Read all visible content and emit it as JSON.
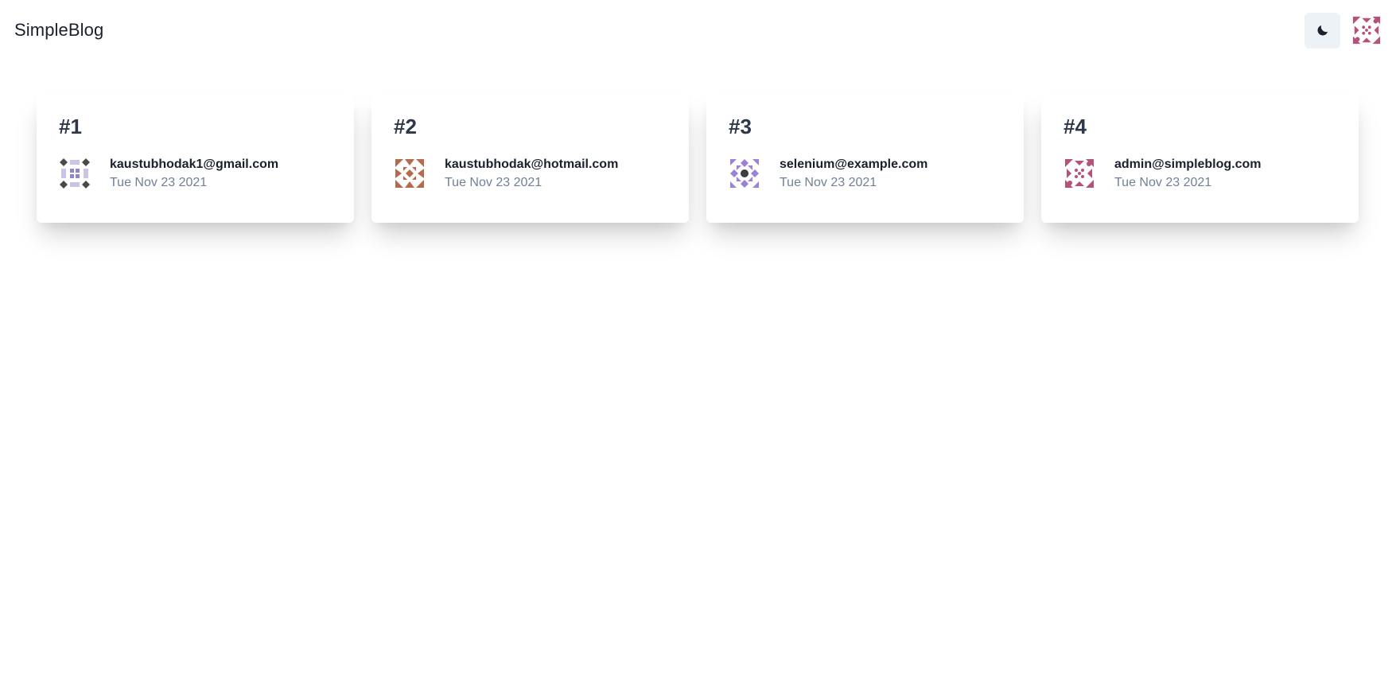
{
  "header": {
    "brand": "SimpleBlog",
    "theme_toggle_icon": "moon-icon",
    "avatar_color": "#b5527a"
  },
  "cards": [
    {
      "number": "#1",
      "email": "kaustubhodak1@gmail.com",
      "date": "Tue Nov 23 2021",
      "avatar_color": "#8f86c9",
      "avatar_secondary": "#4a4a4a"
    },
    {
      "number": "#2",
      "email": "kaustubhodak@hotmail.com",
      "date": "Tue Nov 23 2021",
      "avatar_color": "#b46a4c",
      "avatar_secondary": "#b46a4c"
    },
    {
      "number": "#3",
      "email": "selenium@example.com",
      "date": "Tue Nov 23 2021",
      "avatar_color": "#9c82d6",
      "avatar_secondary": "#3d3d3d"
    },
    {
      "number": "#4",
      "email": "admin@simpleblog.com",
      "date": "Tue Nov 23 2021",
      "avatar_color": "#b5527a",
      "avatar_secondary": "#b5527a"
    }
  ]
}
